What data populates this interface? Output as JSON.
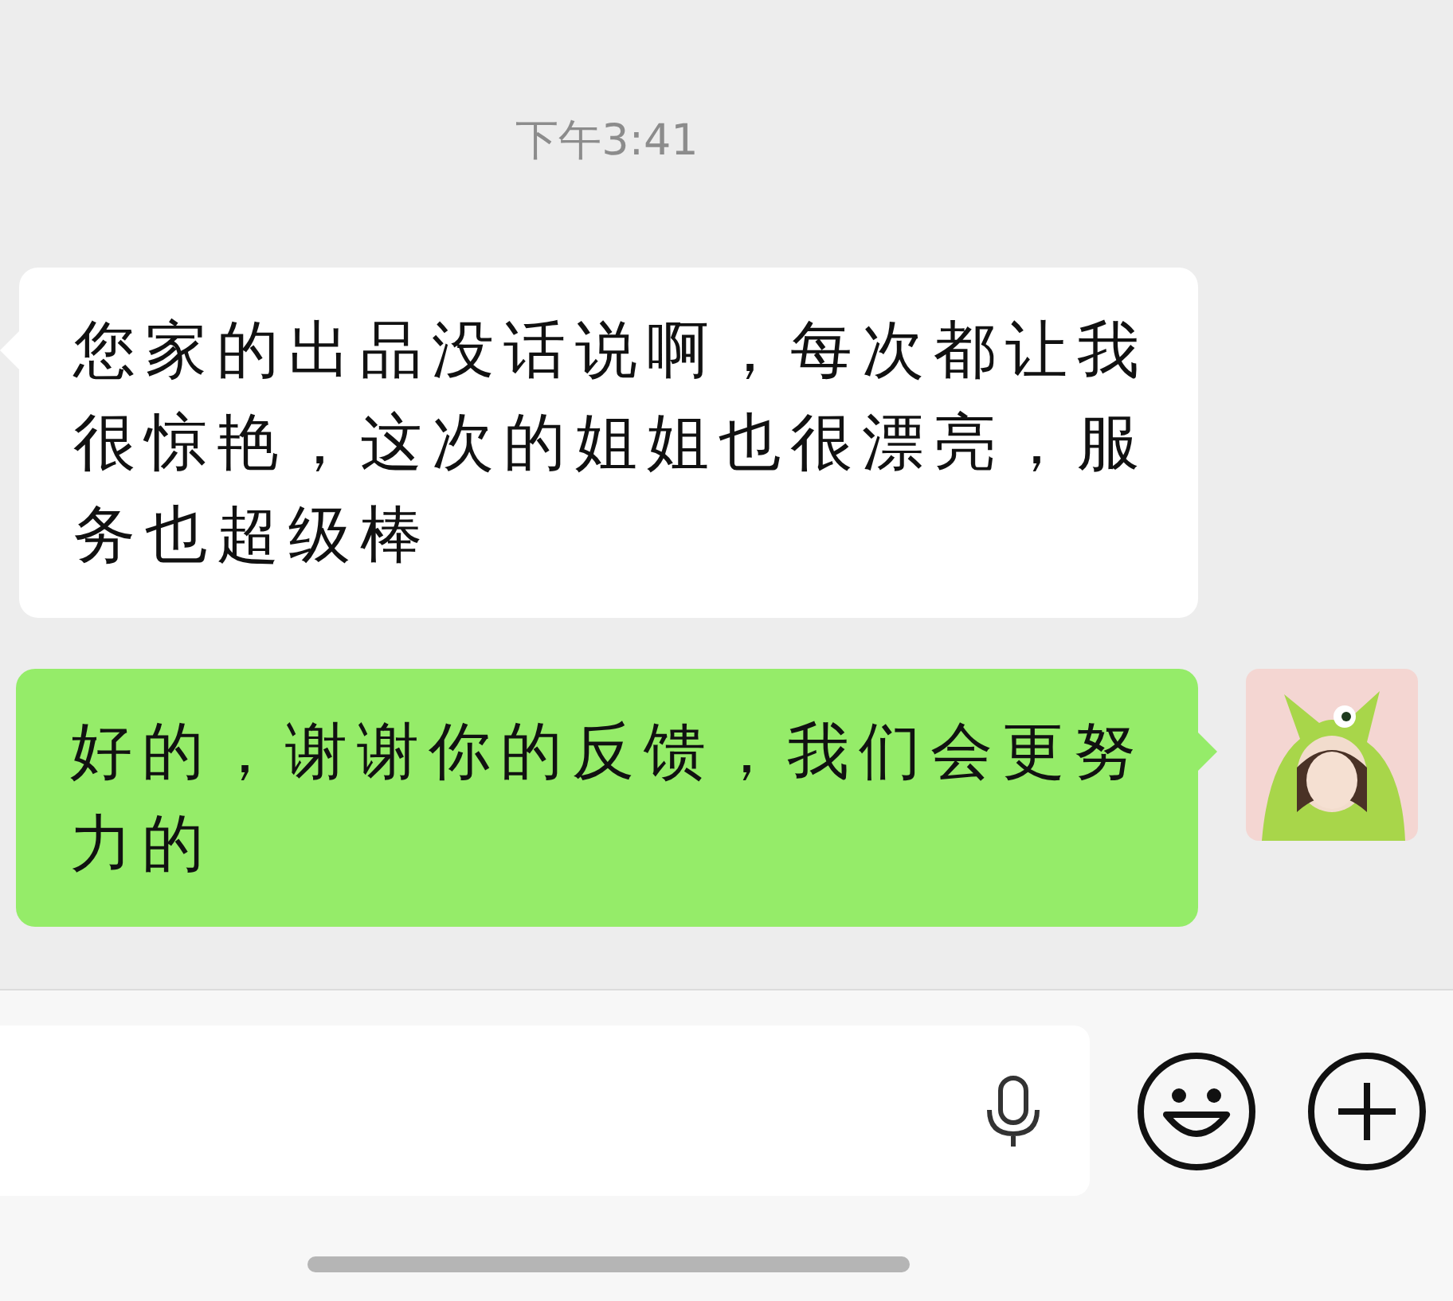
{
  "time": "下午3:41",
  "messages": [
    {
      "kind": "received",
      "text": "您家的出品没话说啊，每次都让我很惊艳，这次的姐姐也很漂亮，服务也超级棒"
    },
    {
      "kind": "sent",
      "text": "好的，谢谢你的反馈，我们会更努力的"
    }
  ]
}
